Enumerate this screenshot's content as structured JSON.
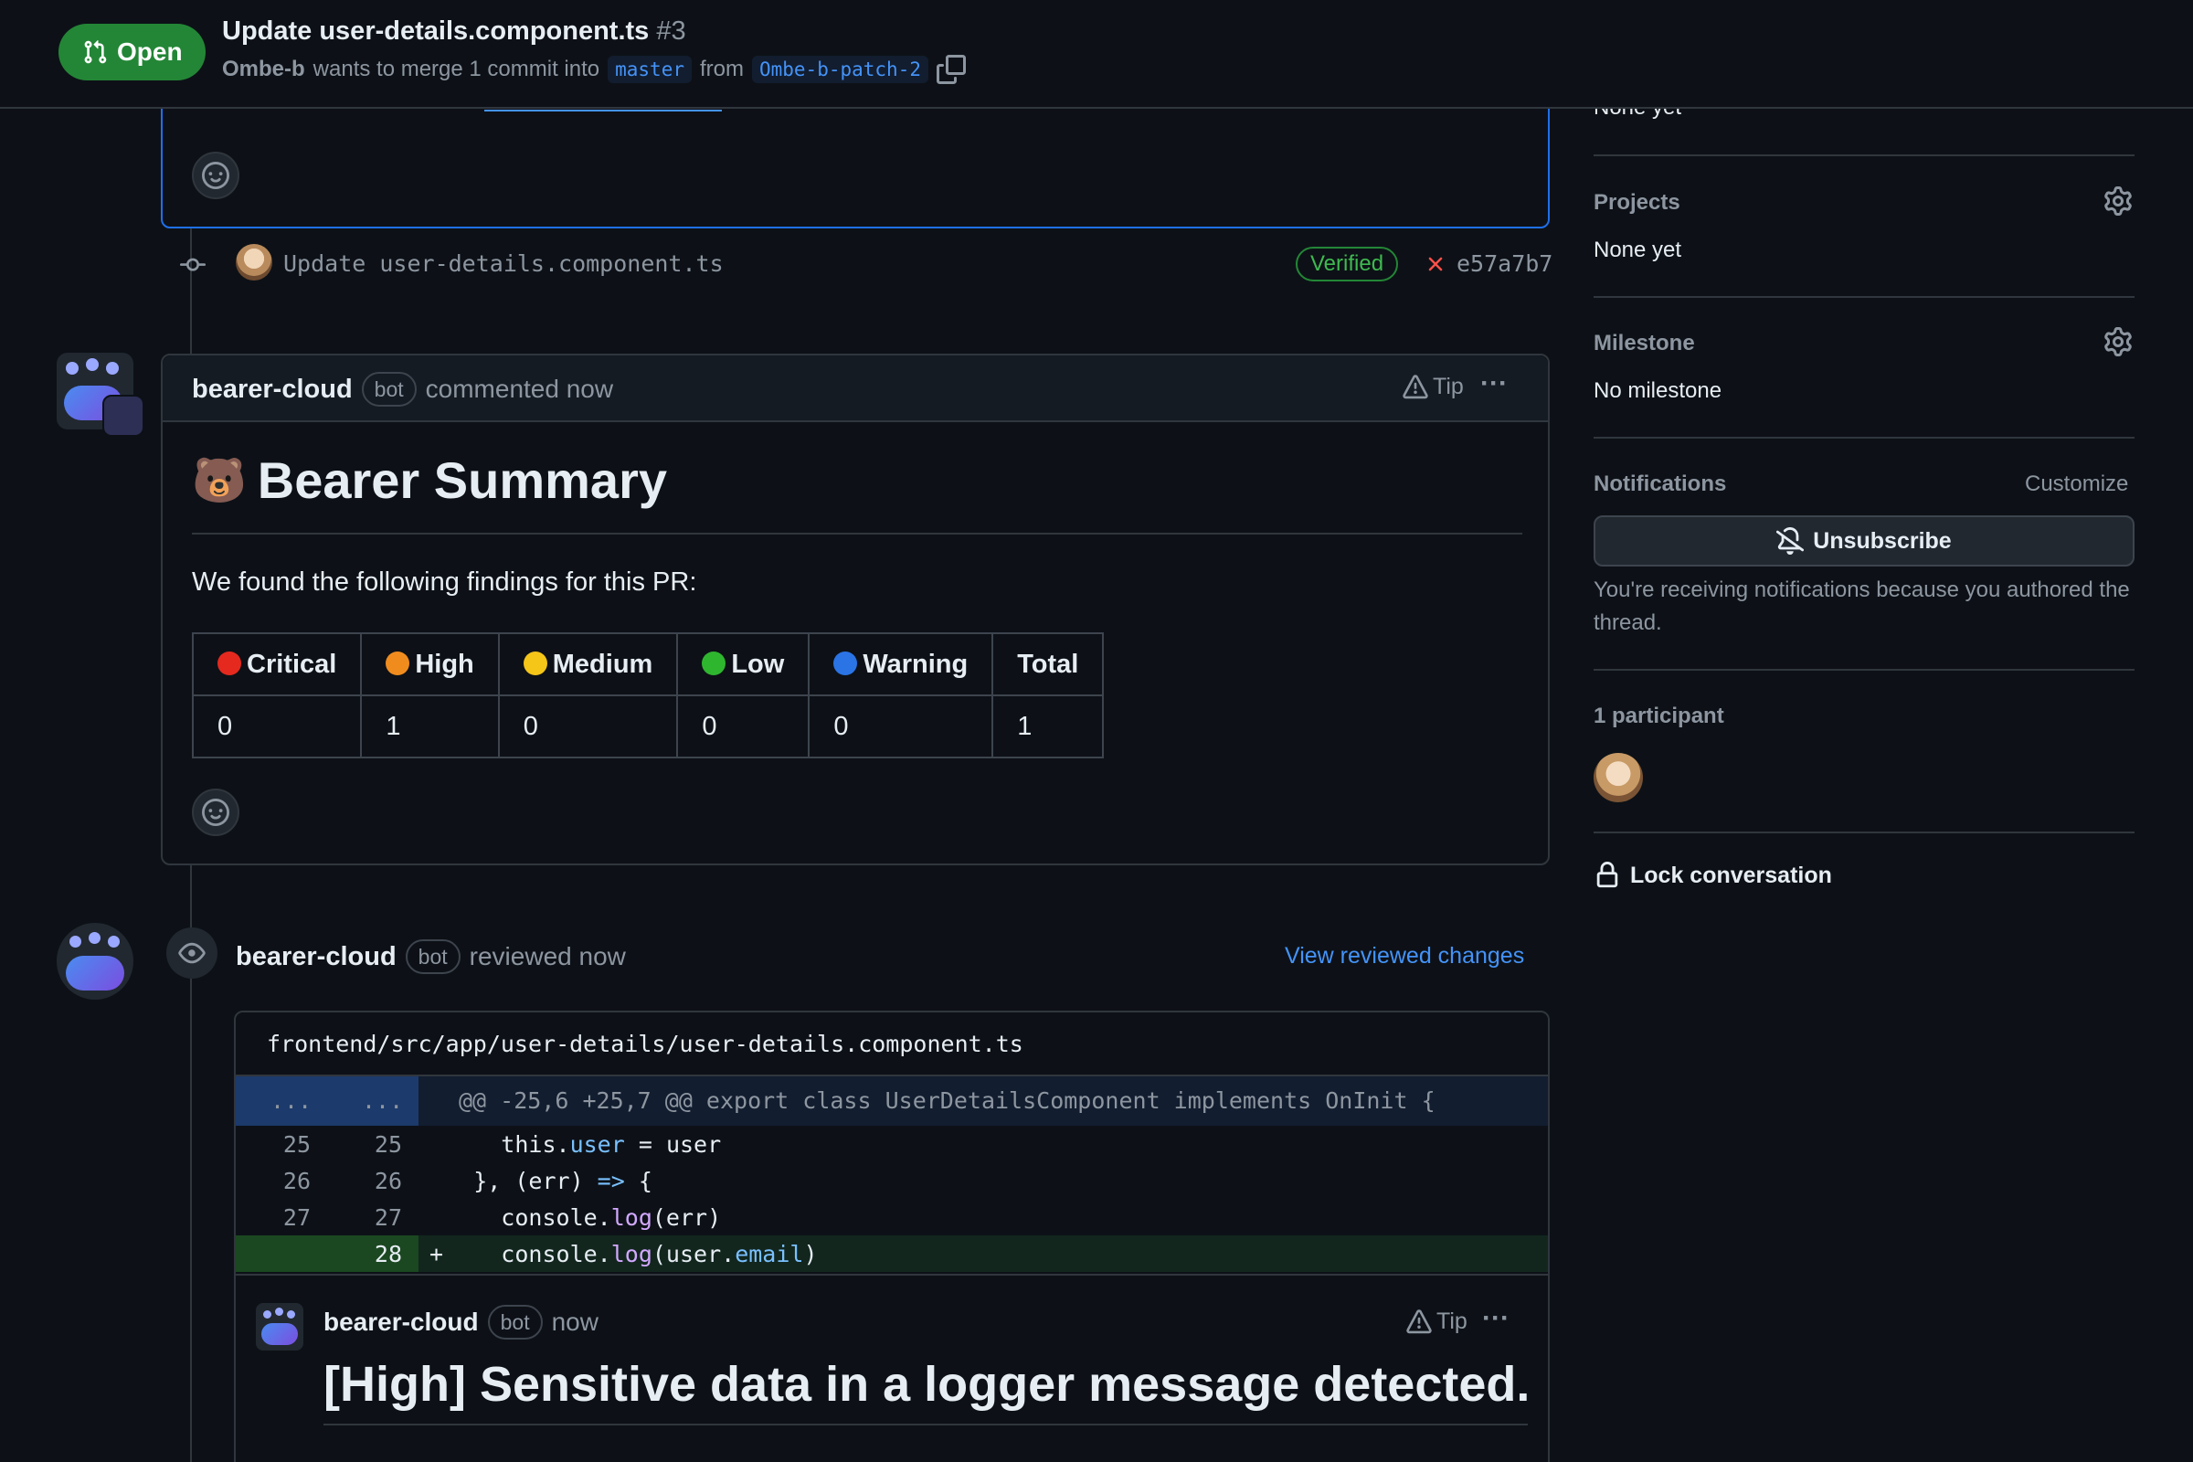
{
  "header": {
    "status": "Open",
    "title": "Update user-details.component.ts",
    "number": "#3",
    "author": "Ombe-b",
    "merge_text_1": "wants to merge 1 commit into",
    "base_branch": "master",
    "from_text": "from",
    "head_branch": "Ombe-b-patch-2"
  },
  "commit": {
    "message": "Update user-details.component.ts",
    "verified": "Verified",
    "sha": "e57a7b7"
  },
  "comment1": {
    "author": "bearer-cloud",
    "bot": "bot",
    "action": "commented now",
    "tip": "Tip",
    "more": "···",
    "emoji": "🐻",
    "heading": "Bearer Summary",
    "intro": "We found the following findings for this PR:",
    "columns": [
      "Critical",
      "High",
      "Medium",
      "Low",
      "Warning",
      "Total"
    ],
    "values": [
      "0",
      "1",
      "0",
      "0",
      "0",
      "1"
    ],
    "colors": {
      "critical": "#e5291f",
      "high": "#f08c1e",
      "medium": "#f5c518",
      "low": "#2fb62f",
      "warning": "#2a74e6"
    }
  },
  "review": {
    "author": "bearer-cloud",
    "bot": "bot",
    "action": "reviewed now",
    "view_changes": "View reviewed changes",
    "file_path": "frontend/src/app/user-details/user-details.component.ts",
    "hunk_left": "...",
    "hunk_right": "...",
    "hunk_header": "@@ -25,6 +25,7 @@ export class UserDetailsComponent implements OnInit {",
    "lines": [
      {
        "old": "25",
        "new": "25",
        "sign": "",
        "pre": "      this.",
        "kw": "user",
        "mid": " = ",
        "fn": "",
        "post": "user"
      },
      {
        "old": "26",
        "new": "26",
        "sign": "",
        "pre": "    }, (err) ",
        "kw": "=>",
        "mid": " {",
        "fn": "",
        "post": ""
      },
      {
        "old": "27",
        "new": "27",
        "sign": "",
        "pre": "      console.",
        "kw": "",
        "mid": "",
        "fn": "log",
        "post": "(err)"
      },
      {
        "old": "",
        "new": "28",
        "sign": "+",
        "pre": "      console.",
        "kw": "",
        "mid": "",
        "fn": "log",
        "post": "(user.email)"
      }
    ],
    "line4_post_a": "(user.",
    "line4_kw": "email",
    "line4_post_b": ")",
    "inline_comment": {
      "author": "bearer-cloud",
      "bot": "bot",
      "time": "now",
      "tip": "Tip",
      "more": "···",
      "heading": "[High] Sensitive data in a logger message detected."
    }
  },
  "sidebar": {
    "prev_value": "None yet",
    "projects_label": "Projects",
    "projects_value": "None yet",
    "milestone_label": "Milestone",
    "milestone_value": "No milestone",
    "notifications_label": "Notifications",
    "customize": "Customize",
    "unsubscribe": "Unsubscribe",
    "notif_reason": "You're receiving notifications because you authored the thread.",
    "participants_label": "1 participant",
    "lock": "Lock conversation"
  }
}
